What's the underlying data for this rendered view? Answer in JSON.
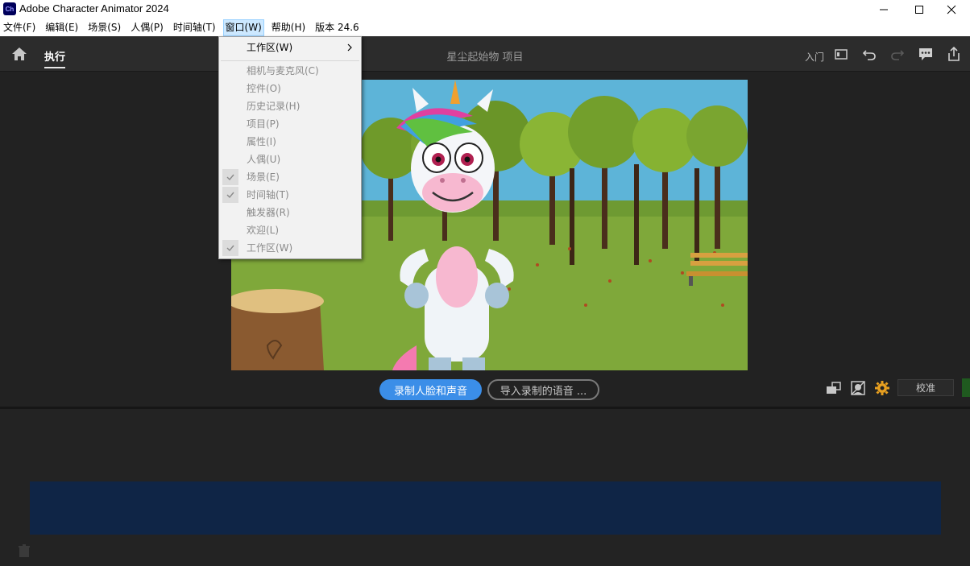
{
  "window": {
    "app_icon_text": "Ch",
    "title": "Adobe Character Animator 2024"
  },
  "menubar": {
    "items": [
      "文件(F)",
      "编辑(E)",
      "场景(S)",
      "人偶(P)",
      "时间轴(T)",
      "窗口(W)",
      "帮助(H)",
      "版本 24.6"
    ],
    "active": "窗口(W)"
  },
  "header": {
    "tab_exec": "执行",
    "project_title": "星尘起始物 项目",
    "entry_label": "入门"
  },
  "window_menu": {
    "workspace_submenu": "工作区(W)",
    "items": [
      {
        "label": "相机与麦克风(C)",
        "checked": false
      },
      {
        "label": "控件(O)",
        "checked": false
      },
      {
        "label": "历史记录(H)",
        "checked": false
      },
      {
        "label": "项目(P)",
        "checked": false
      },
      {
        "label": "属性(I)",
        "checked": false
      },
      {
        "label": "人偶(U)",
        "checked": false
      },
      {
        "label": "场景(E)",
        "checked": true
      },
      {
        "label": "时间轴(T)",
        "checked": true
      },
      {
        "label": "触发器(R)",
        "checked": false
      },
      {
        "label": "欢迎(L)",
        "checked": false
      },
      {
        "label": "工作区(W)",
        "checked": true
      }
    ]
  },
  "controls": {
    "record_button": "录制人脸和声音",
    "import_button": "导入录制的语音 ...",
    "calibrate_button": "校准"
  },
  "colors": {
    "accent": "#3b8ee8",
    "gear": "#e8a020",
    "timeline": "#0f2546"
  }
}
